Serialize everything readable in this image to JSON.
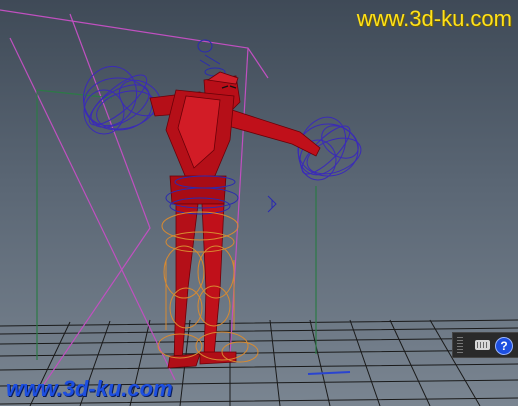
{
  "watermark": {
    "top_text": "www.3d-ku.com",
    "bottom_text": "www.3d-ku.com",
    "top_color": "#ffe11a",
    "bottom_color": "#1d4fe0"
  },
  "scene": {
    "background_top": "#3f4a57",
    "background_bottom": "#7a8591",
    "grid_color": "#1a1a1a",
    "character_color": "#c0101a",
    "camera_frustum_color": "#c050c0",
    "wire_blue": "#2a2ab0",
    "wire_orange": "#d88a30"
  },
  "help_panel": {
    "icons": [
      "keyboard-icon",
      "help-icon"
    ],
    "help_glyph": "?"
  }
}
